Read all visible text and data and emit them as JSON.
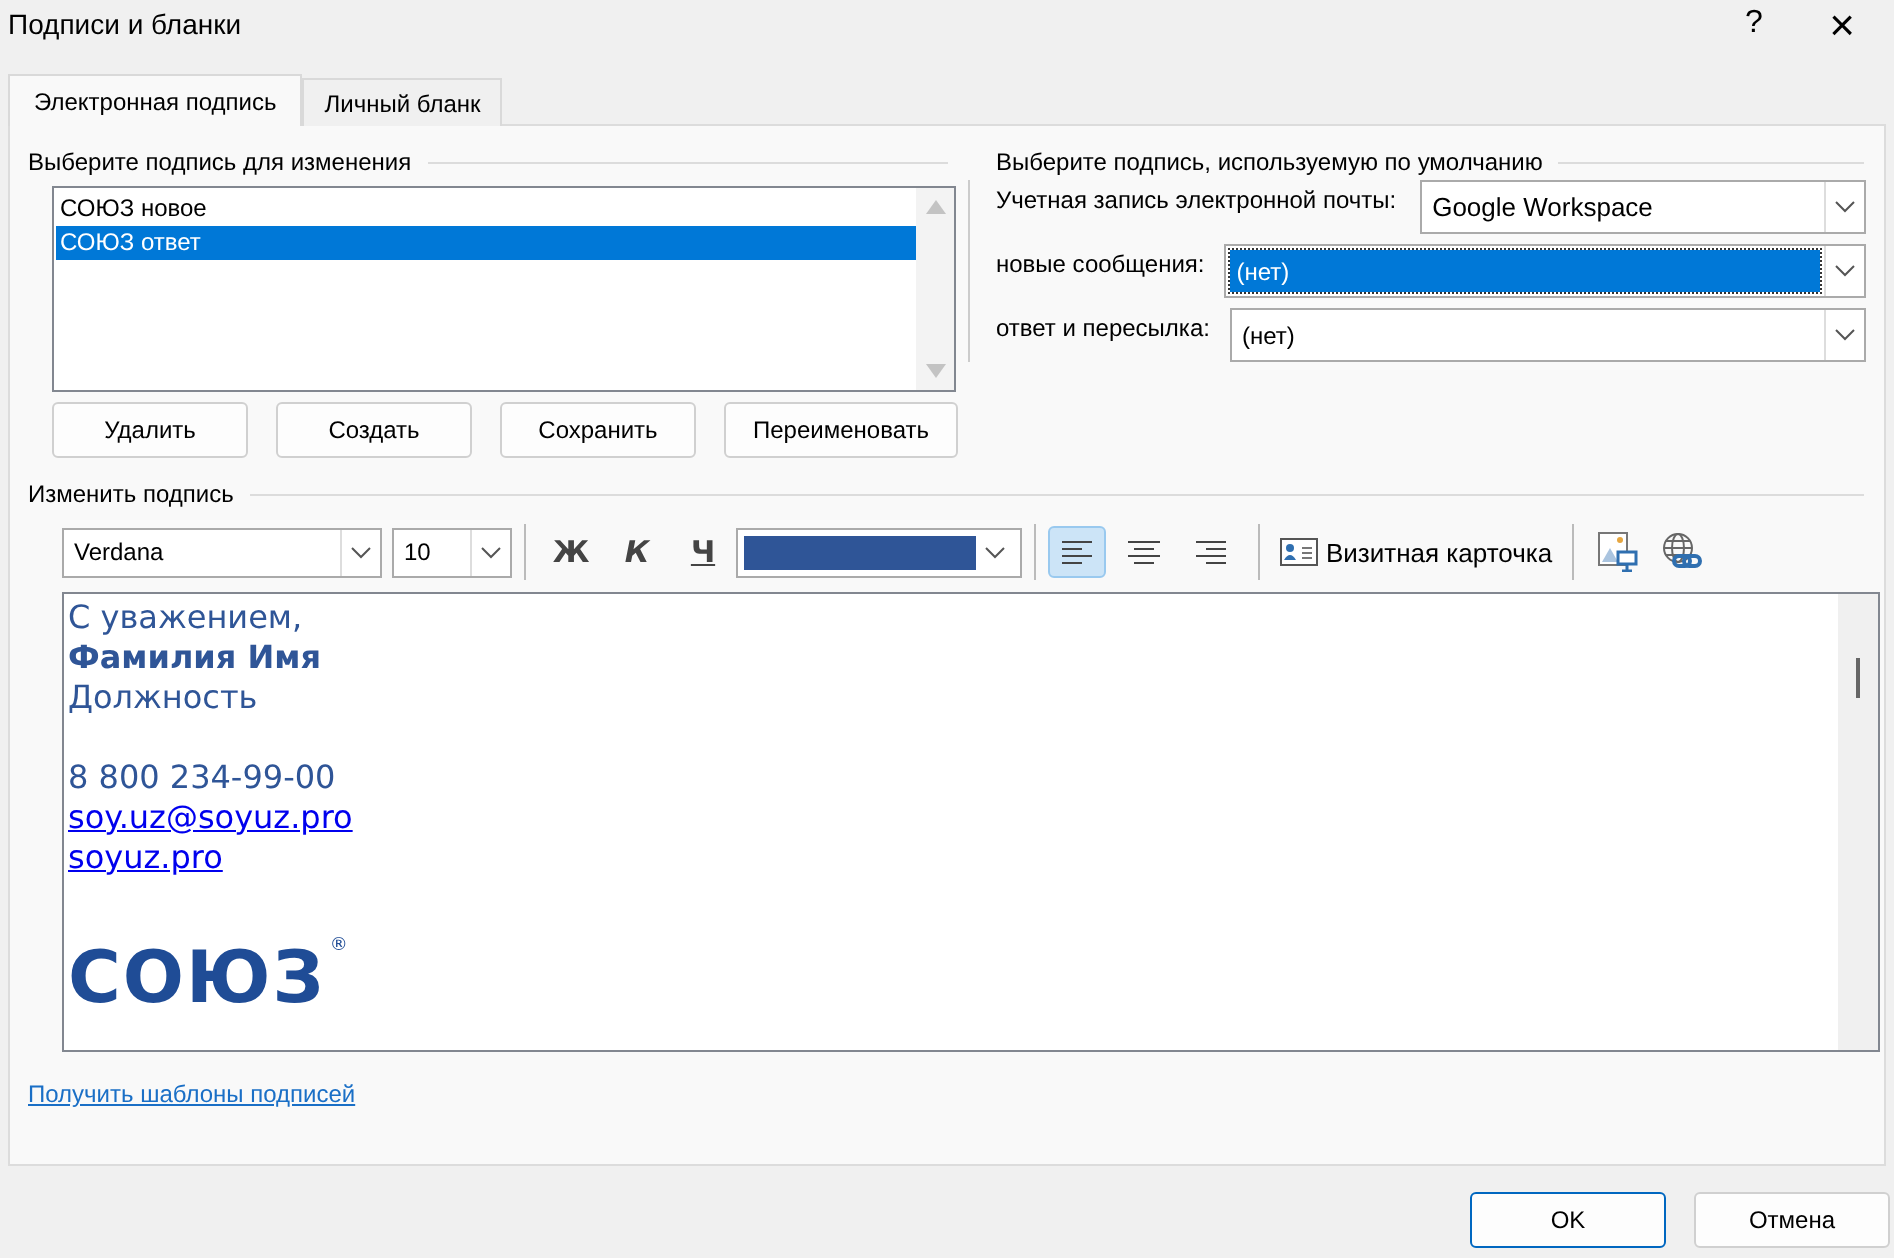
{
  "window": {
    "title": "Подписи и бланки",
    "help": "?",
    "close": "×"
  },
  "tabs": [
    {
      "label": "Электронная подпись",
      "selected": true
    },
    {
      "label": "Личный бланк",
      "selected": false
    }
  ],
  "edit_group": {
    "legend": "Выберите подпись для изменения",
    "signatures": [
      {
        "name": "СОЮЗ новое",
        "selected": false
      },
      {
        "name": "СОЮЗ ответ",
        "selected": true
      }
    ],
    "buttons": [
      "Удалить",
      "Создать",
      "Сохранить",
      "Переименовать"
    ]
  },
  "default_group": {
    "legend": "Выберите подпись, используемую по умолчанию",
    "fields": [
      {
        "label": "Учетная запись электронной почты:",
        "value": "Google Workspace",
        "focused": false
      },
      {
        "label": "новые сообщения:",
        "value": "(нет)",
        "focused": true
      },
      {
        "label": "ответ и пересылка:",
        "value": "(нет)",
        "focused": false
      }
    ]
  },
  "editor": {
    "legend": "Изменить подпись",
    "font": "Verdana",
    "size": "10",
    "bold": "Ж",
    "italic": "К",
    "underline": "Ч",
    "color": "#2f5597",
    "alignment": [
      {
        "kind": "left",
        "selected": true
      },
      {
        "kind": "center",
        "selected": false
      },
      {
        "kind": "right",
        "selected": false
      }
    ],
    "business_card": "Визитная карточка",
    "lines": [
      {
        "kind": "text",
        "text": "С уважением,"
      },
      {
        "kind": "bold",
        "text": "Фамилия Имя"
      },
      {
        "kind": "text",
        "text": "Должность"
      },
      {
        "kind": "blank"
      },
      {
        "kind": "text",
        "text": "8 800 234-99-00"
      },
      {
        "kind": "link",
        "text": "soy.uz@soyuz.pro"
      },
      {
        "kind": "link",
        "text": "soyuz.pro"
      },
      {
        "kind": "blank"
      },
      {
        "kind": "logo",
        "text": "СОЮЗ",
        "mark": "®"
      }
    ]
  },
  "templates_link": "Получить шаблоны подписей",
  "buttons": [
    {
      "label": "OK",
      "default": true
    },
    {
      "label": "Отмена",
      "default": false
    }
  ]
}
